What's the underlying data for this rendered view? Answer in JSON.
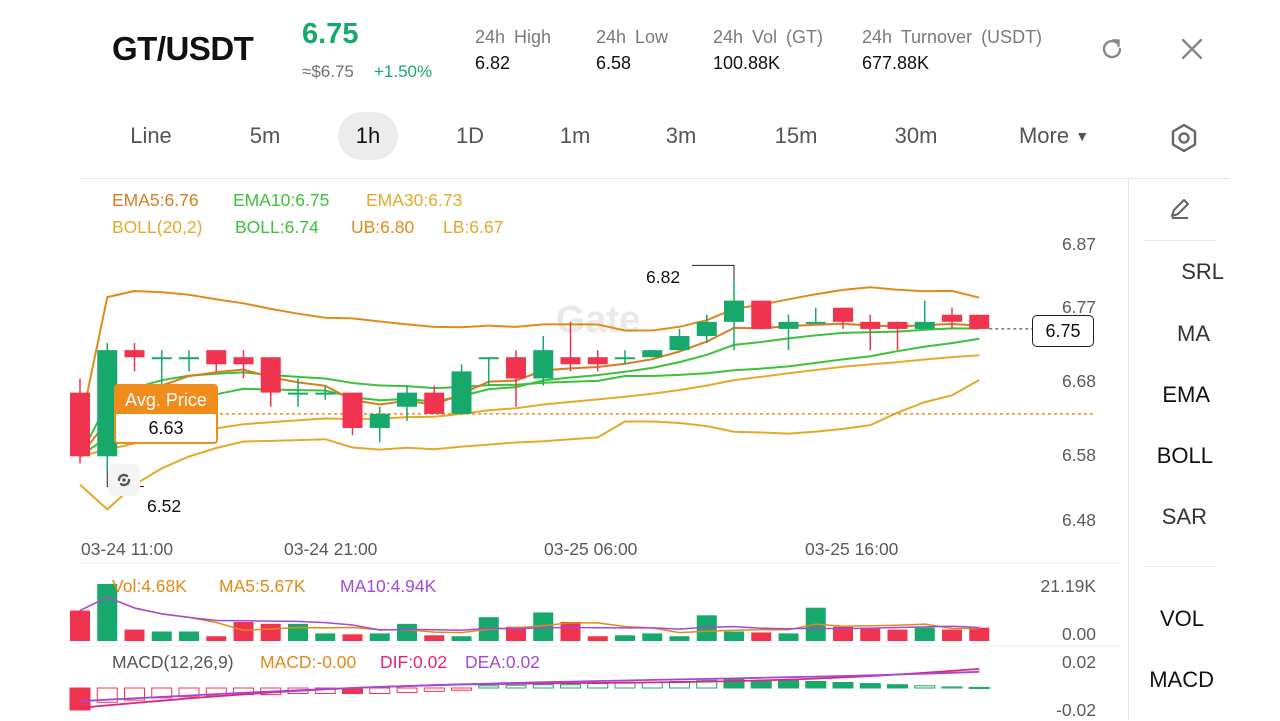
{
  "header": {
    "pair": "GT/USDT",
    "last_price": "6.75",
    "fiat_price": "≈$6.75",
    "change": "+1.50%",
    "stats": [
      {
        "label": "24h  High",
        "value": "6.82"
      },
      {
        "label": "24h  Low",
        "value": "6.58"
      },
      {
        "label": "24h  Vol (GT)",
        "value": "100.88K"
      },
      {
        "label": "24h  Turnover (USDT)",
        "value": "677.88K"
      }
    ],
    "icons": [
      "refresh-icon",
      "close-icon"
    ]
  },
  "tabs": {
    "items": [
      "Line",
      "5m",
      "1h",
      "1D",
      "1m",
      "3m",
      "15m",
      "30m"
    ],
    "active": "1h",
    "more_label": "More"
  },
  "indicators": {
    "ema": [
      {
        "text": "EMA5:6.76",
        "color": "#d97b1f"
      },
      {
        "text": "EMA10:6.75",
        "color": "#3cc13b"
      },
      {
        "text": "EMA30:6.73",
        "color": "#e3a92a"
      }
    ],
    "boll": [
      {
        "text": "BOLL(20,2)",
        "color": "#e3a92a"
      },
      {
        "text": "BOLL:6.74",
        "color": "#3cc13b"
      },
      {
        "text": "UB:6.80",
        "color": "#e08a1a"
      },
      {
        "text": "LB:6.67",
        "color": "#e3a92a"
      }
    ]
  },
  "price_axis": [
    "6.87",
    "6.77",
    "6.68",
    "6.58",
    "6.48"
  ],
  "time_axis": [
    "03-24 11:00",
    "03-24 21:00",
    "03-25 06:00",
    "03-25 16:00"
  ],
  "price_labels": {
    "high_marker": "6.82",
    "low_marker": "6.52",
    "current": "6.75",
    "avg_title": "Avg. Price",
    "avg_value": "6.63"
  },
  "watermark": "Gate",
  "volume": {
    "labels": [
      {
        "text": "Vol:4.68K",
        "color": "#e08a1a"
      },
      {
        "text": "MA5:5.67K",
        "color": "#e08a1a"
      },
      {
        "text": "MA10:4.94K",
        "color": "#a24ad6"
      }
    ],
    "axis": [
      "21.19K",
      "0.00"
    ]
  },
  "macd": {
    "labels": [
      {
        "text": "MACD(12,26,9)",
        "color": "#555555"
      },
      {
        "text": "MACD:-0.00",
        "color": "#e08a1a"
      },
      {
        "text": "DIF:0.02",
        "color": "#e0257a"
      },
      {
        "text": "DEA:0.02",
        "color": "#a24ad6"
      }
    ],
    "axis": [
      "0.02",
      "-0.02"
    ]
  },
  "side_menu": [
    "SRL",
    "MA",
    "EMA",
    "BOLL",
    "SAR",
    "VOL",
    "MACD"
  ],
  "colors": {
    "up": "#17a86b",
    "down": "#f0344f",
    "accent_orange": "#f08c1c"
  },
  "chart_data": {
    "type": "candlestick",
    "candles": [
      {
        "o": 6.66,
        "h": 6.68,
        "l": 6.56,
        "c": 6.57
      },
      {
        "o": 6.57,
        "h": 6.73,
        "l": 6.55,
        "c": 6.72
      },
      {
        "o": 6.72,
        "h": 6.73,
        "l": 6.69,
        "c": 6.71
      },
      {
        "o": 6.71,
        "h": 6.72,
        "l": 6.67,
        "c": 6.71
      },
      {
        "o": 6.71,
        "h": 6.72,
        "l": 6.69,
        "c": 6.71
      },
      {
        "o": 6.72,
        "h": 6.72,
        "l": 6.69,
        "c": 6.7
      },
      {
        "o": 6.71,
        "h": 6.72,
        "l": 6.68,
        "c": 6.7
      },
      {
        "o": 6.71,
        "h": 6.7,
        "l": 6.64,
        "c": 6.66
      },
      {
        "o": 6.66,
        "h": 6.68,
        "l": 6.64,
        "c": 6.66
      },
      {
        "o": 6.66,
        "h": 6.67,
        "l": 6.65,
        "c": 6.66
      },
      {
        "o": 6.66,
        "h": 6.66,
        "l": 6.6,
        "c": 6.61
      },
      {
        "o": 6.61,
        "h": 6.64,
        "l": 6.59,
        "c": 6.63
      },
      {
        "o": 6.64,
        "h": 6.67,
        "l": 6.62,
        "c": 6.66
      },
      {
        "o": 6.66,
        "h": 6.67,
        "l": 6.63,
        "c": 6.63
      },
      {
        "o": 6.63,
        "h": 6.7,
        "l": 6.63,
        "c": 6.69
      },
      {
        "o": 6.71,
        "h": 6.71,
        "l": 6.67,
        "c": 6.71
      },
      {
        "o": 6.71,
        "h": 6.72,
        "l": 6.64,
        "c": 6.68
      },
      {
        "o": 6.68,
        "h": 6.74,
        "l": 6.67,
        "c": 6.72
      },
      {
        "o": 6.71,
        "h": 6.76,
        "l": 6.69,
        "c": 6.7
      },
      {
        "o": 6.71,
        "h": 6.72,
        "l": 6.69,
        "c": 6.7
      },
      {
        "o": 6.71,
        "h": 6.72,
        "l": 6.7,
        "c": 6.71
      },
      {
        "o": 6.71,
        "h": 6.72,
        "l": 6.71,
        "c": 6.72
      },
      {
        "o": 6.72,
        "h": 6.75,
        "l": 6.72,
        "c": 6.74
      },
      {
        "o": 6.74,
        "h": 6.77,
        "l": 6.73,
        "c": 6.76
      },
      {
        "o": 6.76,
        "h": 6.82,
        "l": 6.72,
        "c": 6.79
      },
      {
        "o": 6.79,
        "h": 6.79,
        "l": 6.75,
        "c": 6.75
      },
      {
        "o": 6.75,
        "h": 6.77,
        "l": 6.72,
        "c": 6.76
      },
      {
        "o": 6.76,
        "h": 6.78,
        "l": 6.76,
        "c": 6.76
      },
      {
        "o": 6.78,
        "h": 6.78,
        "l": 6.75,
        "c": 6.76
      },
      {
        "o": 6.76,
        "h": 6.77,
        "l": 6.72,
        "c": 6.75
      },
      {
        "o": 6.76,
        "h": 6.76,
        "l": 6.72,
        "c": 6.75
      },
      {
        "o": 6.75,
        "h": 6.79,
        "l": 6.75,
        "c": 6.76
      },
      {
        "o": 6.77,
        "h": 6.78,
        "l": 6.75,
        "c": 6.76
      },
      {
        "o": 6.77,
        "h": 6.77,
        "l": 6.75,
        "c": 6.75
      }
    ],
    "volume_values": [
      3.2,
      6.0,
      1.2,
      1.0,
      1.0,
      0.5,
      2.0,
      1.8,
      1.8,
      0.8,
      0.7,
      0.8,
      1.8,
      0.6,
      0.5,
      2.5,
      1.5,
      3.0,
      2.0,
      0.5,
      0.6,
      0.8,
      0.5,
      2.7,
      1.0,
      0.9,
      0.8,
      3.5,
      1.5,
      1.3,
      1.2,
      1.4,
      1.2,
      1.4
    ],
    "macd_values": [
      -0.02,
      -0.013,
      -0.011,
      -0.009,
      -0.008,
      -0.007,
      -0.006,
      -0.006,
      -0.005,
      -0.005,
      -0.005,
      -0.005,
      -0.004,
      -0.003,
      -0.002,
      0.002,
      0.0025,
      0.003,
      0.003,
      0.004,
      0.0045,
      0.005,
      0.006,
      0.007,
      0.008,
      0.007,
      0.007,
      0.006,
      0.005,
      0.004,
      0.003,
      0.002,
      0.001,
      0.0005
    ],
    "ylim": [
      6.48,
      6.87
    ],
    "avg_price": 6.63,
    "current_price": 6.75
  }
}
